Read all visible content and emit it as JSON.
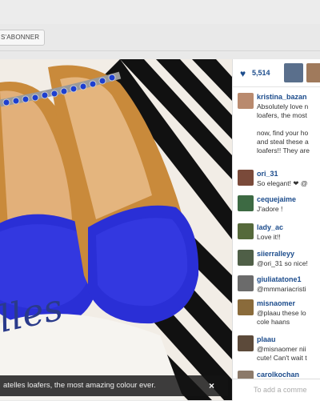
{
  "header": {
    "subscribe_label": "S'ABONNER"
  },
  "photo": {
    "brand_text": "lles",
    "caption": "atelles loafers, the most amazing colour ever.",
    "close_label": "×"
  },
  "likes": {
    "count": "5,514"
  },
  "comments": [
    {
      "user": "kristina_bazan",
      "lines": [
        "Absolutely love n",
        "loafers, the most",
        "",
        "now, find your ho",
        "and steal these a",
        "loafers!! They are"
      ],
      "avatar_color": "#b98a6e"
    },
    {
      "user": "ori_31",
      "lines": [
        "So elegant! ❤ @"
      ],
      "avatar_color": "#7a4a3a"
    },
    {
      "user": "cequejaime",
      "lines": [
        "J'adore !"
      ],
      "avatar_color": "#3d6a43"
    },
    {
      "user": "lady_ac",
      "lines": [
        "Love it!!"
      ],
      "avatar_color": "#55693a"
    },
    {
      "user": "siierralleyy",
      "lines": [
        "@ori_31 so nice!"
      ],
      "avatar_color": "#4f5f47"
    },
    {
      "user": "giuliatatone1",
      "lines": [
        "@mmmariacristi"
      ],
      "avatar_color": "#6b6b6b"
    },
    {
      "user": "misnaomer",
      "lines": [
        "@plaau these lo",
        "cole haans"
      ],
      "avatar_color": "#8a6b3b"
    },
    {
      "user": "plaau",
      "lines": [
        "@misnaomer nii",
        "cute! Can't wait t"
      ],
      "avatar_color": "#5c4a3a"
    },
    {
      "user": "carolkochan",
      "lines": [
        ""
      ],
      "avatar_color": "#8c7a6a"
    }
  ],
  "add_comment": {
    "placeholder": "To add a comme"
  },
  "colors": {
    "link": "#1c4c8c",
    "shoe_blue": "#2a2fd6",
    "caption_bg": "#141414"
  }
}
